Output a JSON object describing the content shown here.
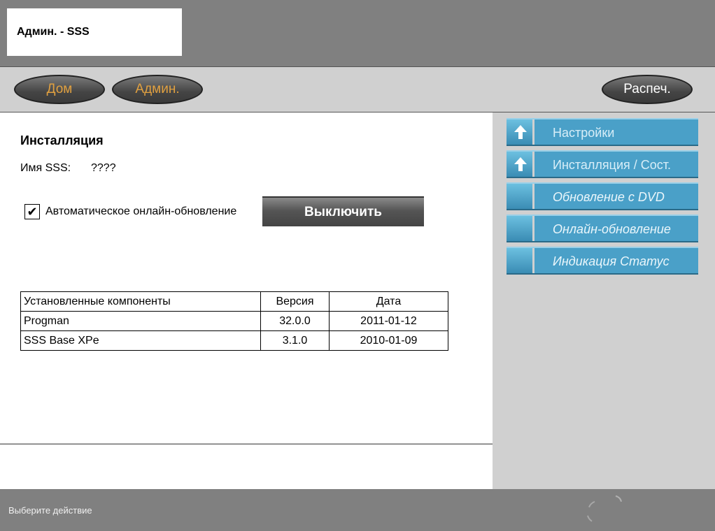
{
  "header": {
    "title": "Админ. - SSS"
  },
  "nav": {
    "home": "Дом",
    "admin": "Админ.",
    "print": "Распеч."
  },
  "main": {
    "heading": "Инсталляция",
    "name_label": "Имя SSS:",
    "name_value": "????",
    "checkbox_mark": "✔",
    "auto_update_label": "Автоматическое онлайн-обновление",
    "auto_update_checked": true,
    "disable_button": "Выключить",
    "table": {
      "headers": [
        "Установленные компоненты",
        "Версия",
        "Дата"
      ],
      "rows": [
        [
          "Progman",
          "32.0.0",
          "2011-01-12"
        ],
        [
          "SSS Base XPe",
          "3.1.0",
          "2010-01-09"
        ]
      ]
    }
  },
  "sidebar": {
    "items": [
      {
        "label": "Настройки",
        "icon": "up-arrow-icon"
      },
      {
        "label": "Инсталляция / Сост.",
        "icon": "up-arrow-icon"
      },
      {
        "label": "Обновление с DVD",
        "icon": ""
      },
      {
        "label": "Онлайн-обновление",
        "icon": ""
      },
      {
        "label": "Индикация Статус",
        "icon": ""
      }
    ]
  },
  "footer": {
    "status": "Выберите действие"
  },
  "colors": {
    "accent_orange": "#e0a040",
    "sidebar_button": "#4aa0c8",
    "background_gray": "#808080",
    "panel_gray": "#d0d0d0"
  }
}
